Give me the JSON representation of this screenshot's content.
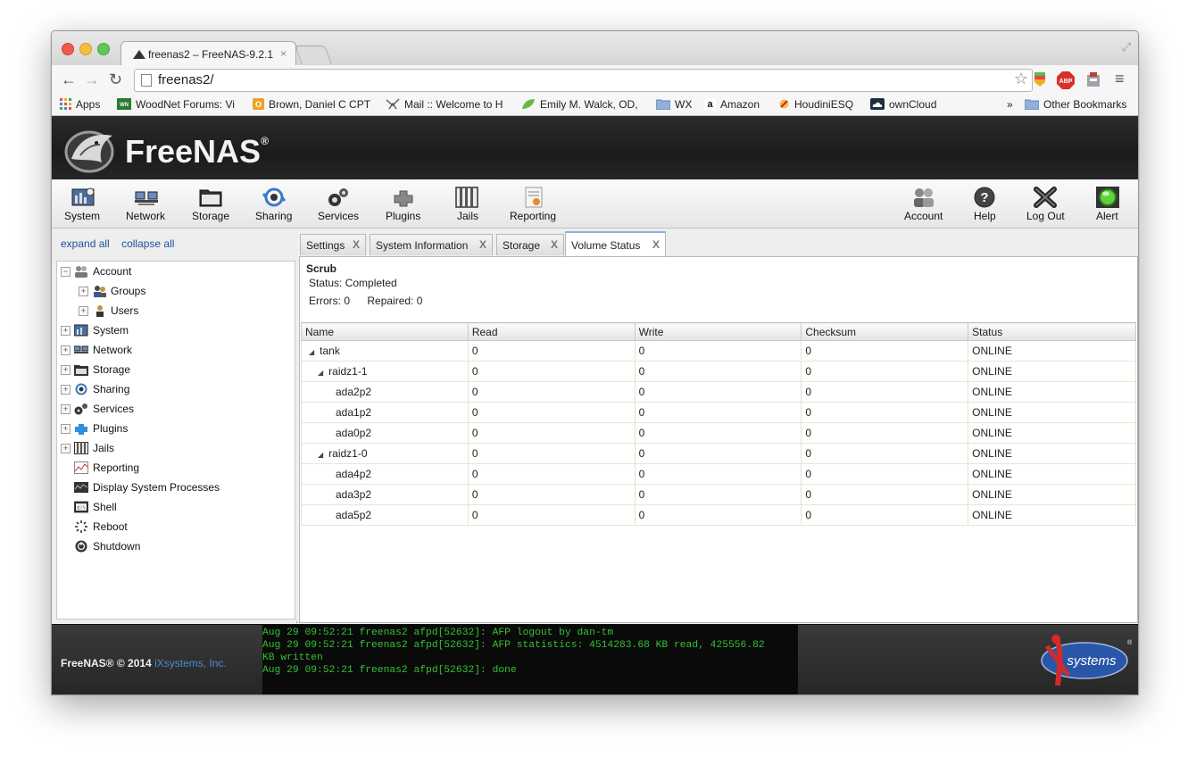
{
  "browser": {
    "tab_title": "freenas2 – FreeNAS-9.2.1.",
    "tab_close": "×",
    "url": "freenas2/",
    "bookmarks": [
      {
        "label": "Apps"
      },
      {
        "label": "WoodNet Forums: Vi"
      },
      {
        "label": "Brown, Daniel C CPT"
      },
      {
        "label": "Mail :: Welcome to H"
      },
      {
        "label": "Emily M. Walck, OD,"
      },
      {
        "label": "WX"
      },
      {
        "label": "Amazon"
      },
      {
        "label": "HoudiniESQ"
      },
      {
        "label": "ownCloud"
      }
    ],
    "bookmarks_more": "»",
    "other_bookmarks": "Other Bookmarks"
  },
  "app": {
    "logo_text": "FreeNAS",
    "logo_mark": "®"
  },
  "nav": {
    "left": [
      "System",
      "Network",
      "Storage",
      "Sharing",
      "Services",
      "Plugins",
      "Jails",
      "Reporting"
    ],
    "right": [
      "Account",
      "Help",
      "Log Out",
      "Alert"
    ]
  },
  "sidebar": {
    "expand_all": "expand all",
    "collapse_all": "collapse all",
    "tree": [
      {
        "label": "Account",
        "toggle": "−"
      },
      {
        "label": "Groups",
        "toggle": "+"
      },
      {
        "label": "Users",
        "toggle": "+"
      },
      {
        "label": "System",
        "toggle": "+"
      },
      {
        "label": "Network",
        "toggle": "+"
      },
      {
        "label": "Storage",
        "toggle": "+"
      },
      {
        "label": "Sharing",
        "toggle": "+"
      },
      {
        "label": "Services",
        "toggle": "+"
      },
      {
        "label": "Plugins",
        "toggle": "+"
      },
      {
        "label": "Jails",
        "toggle": "+"
      },
      {
        "label": "Reporting"
      },
      {
        "label": "Display System Processes"
      },
      {
        "label": "Shell"
      },
      {
        "label": "Reboot"
      },
      {
        "label": "Shutdown"
      }
    ]
  },
  "main": {
    "tabs": [
      {
        "label": "Settings"
      },
      {
        "label": "System Information"
      },
      {
        "label": "Storage"
      },
      {
        "label": "Volume Status"
      }
    ],
    "tab_close": "X",
    "scrub": {
      "title": "Scrub",
      "status": "Status: Completed",
      "errors": "Errors: 0",
      "repaired": "Repaired: 0"
    },
    "columns": [
      "Name",
      "Read",
      "Write",
      "Checksum",
      "Status"
    ],
    "rows": [
      {
        "name": "tank",
        "read": "0",
        "write": "0",
        "checksum": "0",
        "status": "ONLINE"
      },
      {
        "name": "raidz1-1",
        "read": "0",
        "write": "0",
        "checksum": "0",
        "status": "ONLINE"
      },
      {
        "name": "ada2p2",
        "read": "0",
        "write": "0",
        "checksum": "0",
        "status": "ONLINE"
      },
      {
        "name": "ada1p2",
        "read": "0",
        "write": "0",
        "checksum": "0",
        "status": "ONLINE"
      },
      {
        "name": "ada0p2",
        "read": "0",
        "write": "0",
        "checksum": "0",
        "status": "ONLINE"
      },
      {
        "name": "raidz1-0",
        "read": "0",
        "write": "0",
        "checksum": "0",
        "status": "ONLINE"
      },
      {
        "name": "ada4p2",
        "read": "0",
        "write": "0",
        "checksum": "0",
        "status": "ONLINE"
      },
      {
        "name": "ada3p2",
        "read": "0",
        "write": "0",
        "checksum": "0",
        "status": "ONLINE"
      },
      {
        "name": "ada5p2",
        "read": "0",
        "write": "0",
        "checksum": "0",
        "status": "ONLINE"
      }
    ],
    "caret": "◢"
  },
  "footer": {
    "copyright": "FreeNAS® © 2014",
    "company": "iXsystems, Inc.",
    "console": [
      "Aug 29 09:52:21 freenas2 afpd[52632]: AFP logout by dan-tm",
      "Aug 29 09:52:21 freenas2 afpd[52632]: AFP statistics: 4514283.68 KB read, 425556.82",
      "KB written",
      "Aug 29 09:52:21 freenas2 afpd[52632]: done"
    ],
    "logo_text": "systems",
    "logo_mark": "®"
  },
  "colors": {
    "console_text": "#35c235",
    "link": "#1d4f9e",
    "header_bg": "#1f1f1f"
  }
}
